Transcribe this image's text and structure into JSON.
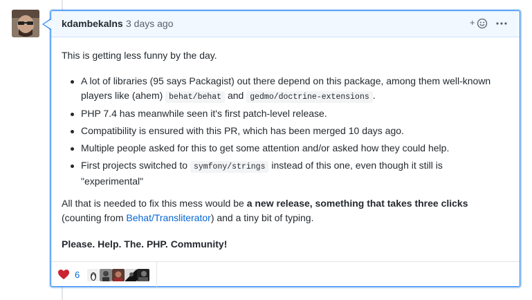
{
  "comment": {
    "author": "kdambekalns",
    "timestamp": "3 days ago",
    "add_reaction_label": "+",
    "body": {
      "intro": "This is getting less funny by the day.",
      "bullets": {
        "b1_text_a": "A lot of libraries (95 says Packagist) out there depend on this package, among them well-known",
        "b1_text_b": "players like (ahem)",
        "b1_code1": "behat/behat",
        "b1_and": "and",
        "b1_code2": "gedmo/doctrine-extensions",
        "b1_period": ".",
        "b2": "PHP 7.4 has meanwhile seen it's first patch-level release.",
        "b3": "Compatibility is ensured with this PR, which has been merged 10 days ago.",
        "b4": "Multiple people asked for this to get some attention and/or asked how they could help.",
        "b5_text_a": "First projects switched to",
        "b5_code": "symfony/strings",
        "b5_text_b": "instead of this one, even though it still is",
        "b5_text_c": "\"experimental\""
      },
      "fix_text_a": "All that is needed to fix this mess would be",
      "fix_bold": "a new release, something that takes three clicks",
      "fix_text_b": "(counting from",
      "fix_link": "Behat/Transliterator",
      "fix_text_c": ") and a tiny bit of typing.",
      "please": "Please. Help. The. PHP. Community!"
    },
    "reactions": {
      "heart_count": "6",
      "heart_color": "#cb2431"
    }
  }
}
